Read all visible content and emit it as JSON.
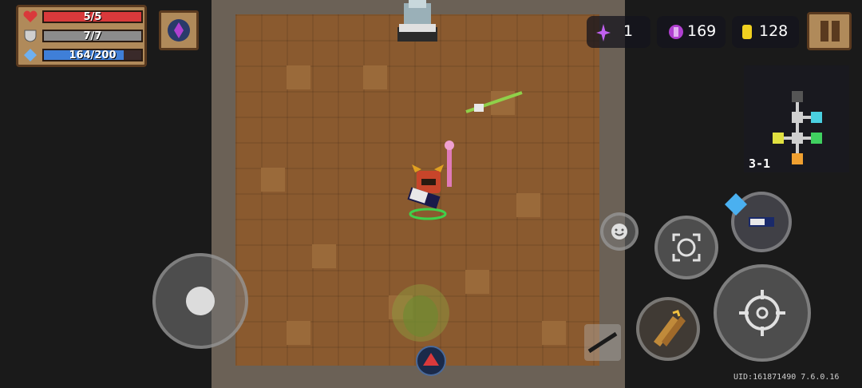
{
  "hud": {
    "health": {
      "text": "5/5",
      "fill": 1.0,
      "color": "#d9393b"
    },
    "armor": {
      "text": "7/7",
      "fill": 1.0,
      "color": "#8c8c8c"
    },
    "energy": {
      "text": "164/200",
      "fill": 0.82,
      "color": "#3f7fd8"
    }
  },
  "resources": {
    "gems_purple": "1",
    "crystals": "169",
    "gold": "128"
  },
  "level": "3-1",
  "uid": "UID:161871490 7.6.0.16",
  "colors": {
    "floor": "#8a5a2f",
    "wall": "#6b6156",
    "panel": "#b08a5a",
    "panel_border": "#5a3a1f"
  },
  "icons": [
    "heart-icon",
    "shield-icon",
    "diamond-icon",
    "buff-icon",
    "purple-gem-icon",
    "crystal-icon",
    "gold-coin-icon",
    "pause-icon",
    "emote-icon",
    "aim-icon",
    "skill-icon",
    "fire-icon",
    "weapon-icon",
    "swap-weapon-icon",
    "joystick"
  ]
}
